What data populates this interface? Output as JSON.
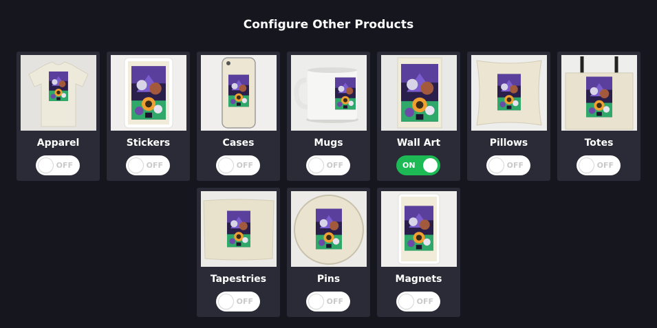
{
  "page": {
    "title": "Configure Other Products"
  },
  "products": [
    {
      "label": "Apparel",
      "state": "OFF",
      "icon": "tshirt-product-image"
    },
    {
      "label": "Stickers",
      "state": "OFF",
      "icon": "sticker-product-image"
    },
    {
      "label": "Cases",
      "state": "OFF",
      "icon": "phone-case-product-image"
    },
    {
      "label": "Mugs",
      "state": "OFF",
      "icon": "mug-product-image"
    },
    {
      "label": "Wall Art",
      "state": "ON",
      "icon": "wall-art-product-image"
    },
    {
      "label": "Pillows",
      "state": "OFF",
      "icon": "pillow-product-image"
    },
    {
      "label": "Totes",
      "state": "OFF",
      "icon": "tote-bag-product-image"
    },
    {
      "label": "Tapestries",
      "state": "OFF",
      "icon": "tapestry-product-image"
    },
    {
      "label": "Pins",
      "state": "OFF",
      "icon": "pin-product-image"
    },
    {
      "label": "Magnets",
      "state": "OFF",
      "icon": "magnet-product-image"
    }
  ],
  "colors": {
    "background": "#16161f",
    "card": "#2b2b37",
    "toggle_on": "#1db954",
    "toggle_off": "#ffffff"
  }
}
